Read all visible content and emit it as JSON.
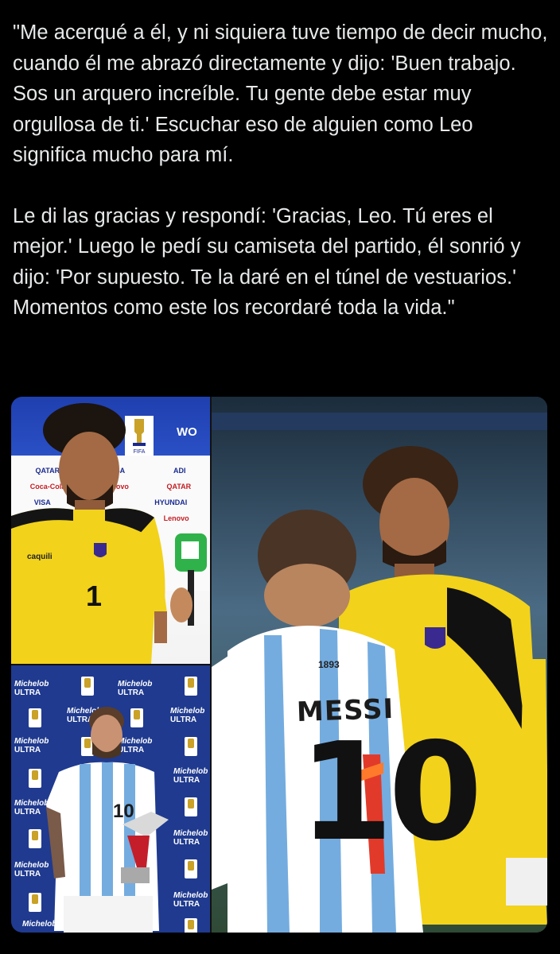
{
  "tweet": {
    "paragraphs": [
      "\"Me acerqué a él, y ni siquiera tuve tiempo de decir mucho, cuando él me abrazó directamente y dijo: 'Buen trabajo. Sos un arquero increíble. Tu gente debe estar muy orgullosa de ti.' Escuchar eso de alguien como Leo significa mucho para mí.",
      "Le di las gracias y respondí: 'Gracias, Leo. Tú eres el mejor.' Luego le pedí su camiseta del partido, él sonrió y dijo: 'Por supuesto. Te la daré en el túnel de vestuarios.' Momentos como este los recordaré toda la vida.\""
    ]
  },
  "media": {
    "interview": {
      "wall_sponsors": [
        "QATAR",
        "VISA",
        "Lenovo",
        "ADI",
        "Coca-Cola",
        "HYUNDAI"
      ],
      "wall_text": "WO",
      "jersey_number": "1",
      "mic_logo": "caquili",
      "wc_label": "FIFA"
    },
    "award": {
      "brand_top": "Michelob",
      "brand_bottom": "ULTRA",
      "jersey_number": "10"
    },
    "stadium": {
      "shirt_name": "MESSI",
      "shirt_number": "10",
      "collar_number": "1893"
    },
    "colors": {
      "background": "#000000",
      "text": "#e7e9ea",
      "gk_yellow": "#f2d21b",
      "arg_blue": "#74acdf"
    }
  }
}
